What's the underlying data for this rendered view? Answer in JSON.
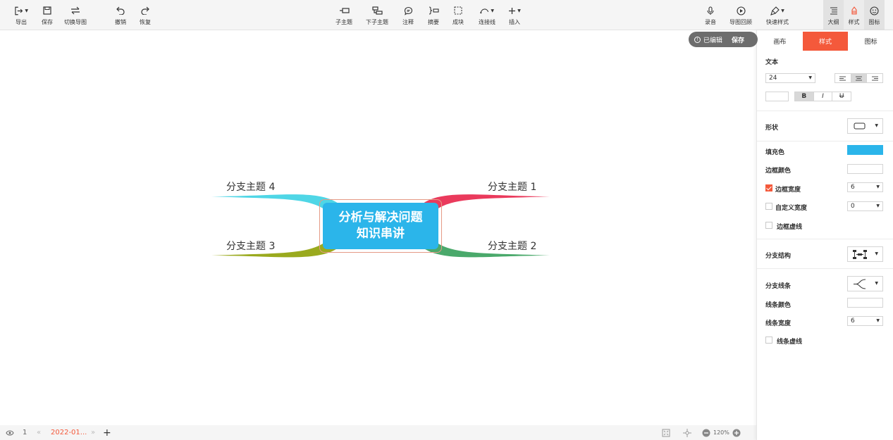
{
  "toolbar": {
    "left": [
      {
        "id": "export",
        "label": "导出",
        "icon": "export-icon",
        "dropdown": true
      },
      {
        "id": "save",
        "label": "保存",
        "icon": "save-icon"
      },
      {
        "id": "switch",
        "label": "切换导图",
        "icon": "switch-icon"
      },
      {
        "id": "undo",
        "label": "撤销",
        "icon": "undo-icon"
      },
      {
        "id": "redo",
        "label": "恢复",
        "icon": "redo-icon"
      }
    ],
    "center": [
      {
        "id": "child-topic",
        "label": "子主题",
        "icon": "child-topic-icon"
      },
      {
        "id": "sub-topic",
        "label": "下子主题",
        "icon": "sub-topic-icon"
      },
      {
        "id": "note",
        "label": "注释",
        "icon": "note-icon"
      },
      {
        "id": "summary",
        "label": "摘要",
        "icon": "summary-icon"
      },
      {
        "id": "block",
        "label": "成块",
        "icon": "block-icon"
      },
      {
        "id": "connect",
        "label": "连接线",
        "icon": "connect-icon",
        "dropdown": true
      },
      {
        "id": "insert",
        "label": "插入",
        "icon": "plus-icon",
        "dropdown": true
      }
    ],
    "right": [
      {
        "id": "record",
        "label": "录音",
        "icon": "microphone-icon"
      },
      {
        "id": "playback",
        "label": "导图回顾",
        "icon": "play-icon"
      },
      {
        "id": "quickstyle",
        "label": "快速样式",
        "icon": "brush-icon",
        "dropdown": true
      },
      {
        "id": "outline",
        "label": "大纲",
        "icon": "outline-icon"
      },
      {
        "id": "style",
        "label": "样式",
        "icon": "style-icon"
      },
      {
        "id": "icons",
        "label": "图标",
        "icon": "smiley-icon"
      }
    ]
  },
  "status": {
    "edited": "已编辑",
    "save": "保存"
  },
  "mindmap": {
    "root": {
      "line1": "分析与解决问题",
      "line2": "知识串讲"
    },
    "branches": [
      {
        "label": "分支主题 1",
        "color": "#ea3a5c"
      },
      {
        "label": "分支主题 2",
        "color": "#4aa96b"
      },
      {
        "label": "分支主题 3",
        "color": "#9aaa1e"
      },
      {
        "label": "分支主题 4",
        "color": "#4fd6e6"
      }
    ],
    "root_color": "#2bb5ea",
    "selection_color": "#e59a86"
  },
  "bottombar": {
    "page": "1",
    "sheet": "2022-01...",
    "zoom": "120%"
  },
  "panel": {
    "tabs": [
      "画布",
      "样式",
      "图标"
    ],
    "active_tab": "样式",
    "text_section": "文本",
    "font_size": "24",
    "bold": "B",
    "italic": "I",
    "strike": "U",
    "shape_label": "形状",
    "fill_label": "填充色",
    "fill_color": "#2bb5ea",
    "border_color_label": "边框颜色",
    "border_width_label": "边框宽度",
    "border_width_value": "6",
    "custom_width_label": "自定义宽度",
    "custom_width_value": "0",
    "border_dash_label": "边框虚线",
    "branch_struct_label": "分支结构",
    "branch_line_label": "分支线条",
    "line_color_label": "线条颜色",
    "line_width_label": "线条宽度",
    "line_width_value": "6",
    "line_dash_label": "线条虚线",
    "accent_color": "#f4593b"
  }
}
